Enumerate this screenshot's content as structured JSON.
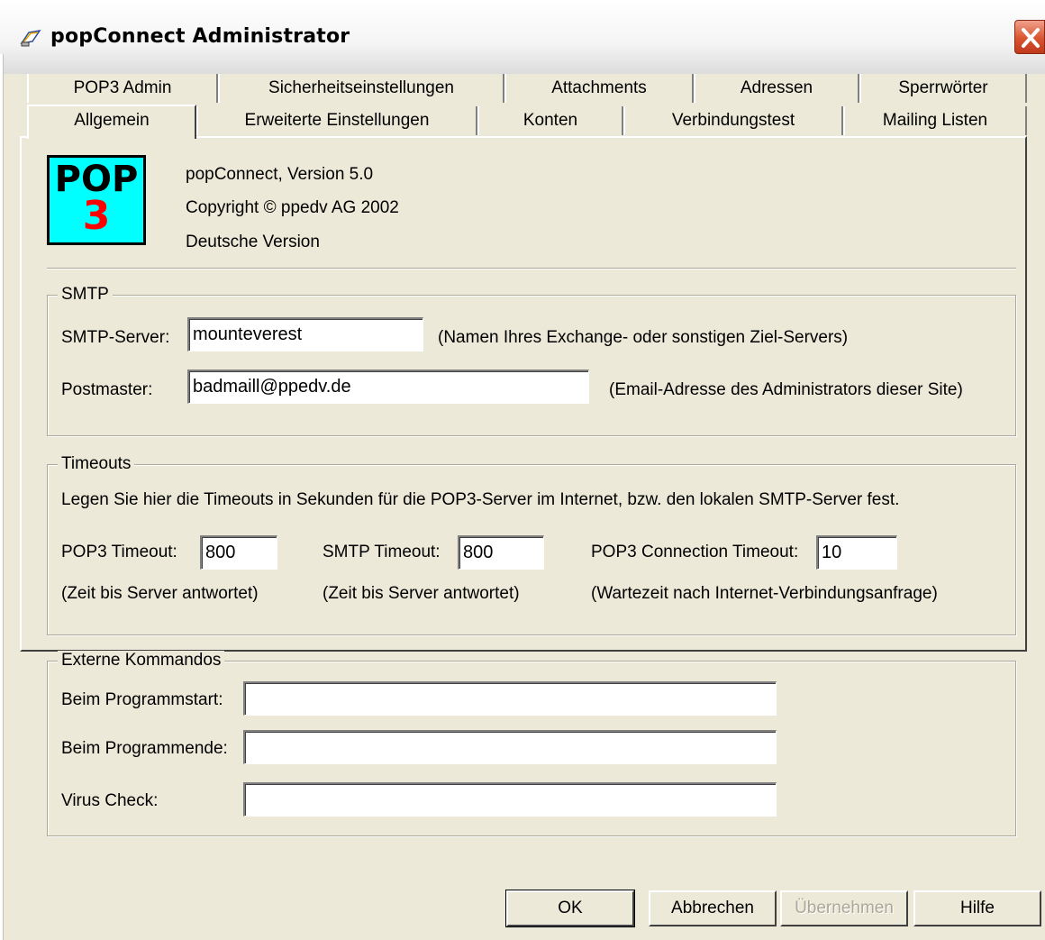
{
  "window": {
    "title": "popConnect Administrator"
  },
  "tabs": {
    "row1": [
      "POP3 Admin",
      "Sicherheitseinstellungen",
      "Attachments",
      "Adressen",
      "Sperrwörter"
    ],
    "row2": [
      "Allgemein",
      "Erweiterte Einstellungen",
      "Konten",
      "Verbindungstest",
      "Mailing Listen"
    ],
    "active": "Allgemein"
  },
  "about": {
    "logo_top": "POP",
    "logo_bottom": "3",
    "version": "popConnect, Version 5.0",
    "copyright": "Copyright © ppedv AG 2002",
    "language": "Deutsche Version"
  },
  "smtp": {
    "group_label": "SMTP",
    "server_label": "SMTP-Server:",
    "server_value": "mounteverest",
    "server_hint": "(Namen Ihres Exchange- oder sonstigen Ziel-Servers)",
    "postmaster_label": "Postmaster:",
    "postmaster_value": "badmaill@ppedv.de",
    "postmaster_hint": "(Email-Adresse des Administrators dieser Site)"
  },
  "timeouts": {
    "group_label": "Timeouts",
    "description": "Legen Sie hier die Timeouts in Sekunden für die POP3-Server im Internet, bzw. den lokalen SMTP-Server fest.",
    "pop3_label": "POP3 Timeout:",
    "pop3_value": "800",
    "pop3_hint": "(Zeit bis Server antwortet)",
    "smtp_label": "SMTP Timeout:",
    "smtp_value": "800",
    "smtp_hint": "(Zeit bis Server antwortet)",
    "conn_label": "POP3 Connection Timeout:",
    "conn_value": "10",
    "conn_hint": "(Wartezeit nach Internet-Verbindungsanfrage)"
  },
  "external": {
    "group_label": "Externe Kommandos",
    "start_label": "Beim Programmstart:",
    "start_value": "",
    "end_label": "Beim Programmende:",
    "end_value": "",
    "virus_label": "Virus Check:",
    "virus_value": ""
  },
  "buttons": {
    "ok": "OK",
    "cancel": "Abbrechen",
    "apply": "Übernehmen",
    "help": "Hilfe"
  },
  "colors": {
    "dialog_bg": "#ece9d8",
    "logo_bg": "#00ffff",
    "logo_digit": "#ff0000",
    "close_button": "#d9542f"
  }
}
